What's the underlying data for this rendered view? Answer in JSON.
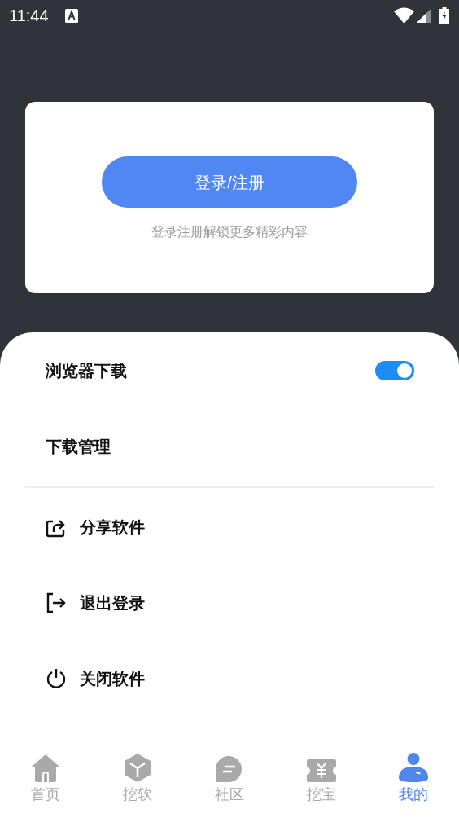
{
  "status_bar": {
    "time": "11:44"
  },
  "login_card": {
    "button": "登录/注册",
    "hint": "登录注册解锁更多精彩内容"
  },
  "settings": [
    {
      "kind": "toggle",
      "label": "浏览器下载",
      "on": true
    },
    {
      "kind": "link",
      "label": "下载管理"
    }
  ],
  "actions": [
    {
      "label": "分享软件"
    },
    {
      "label": "退出登录"
    },
    {
      "label": "关闭软件"
    }
  ],
  "tabs": [
    {
      "label": "首页",
      "selected": false
    },
    {
      "label": "挖软",
      "selected": false
    },
    {
      "label": "社区",
      "selected": false
    },
    {
      "label": "挖宝",
      "selected": false
    },
    {
      "label": "我的",
      "selected": true
    }
  ]
}
